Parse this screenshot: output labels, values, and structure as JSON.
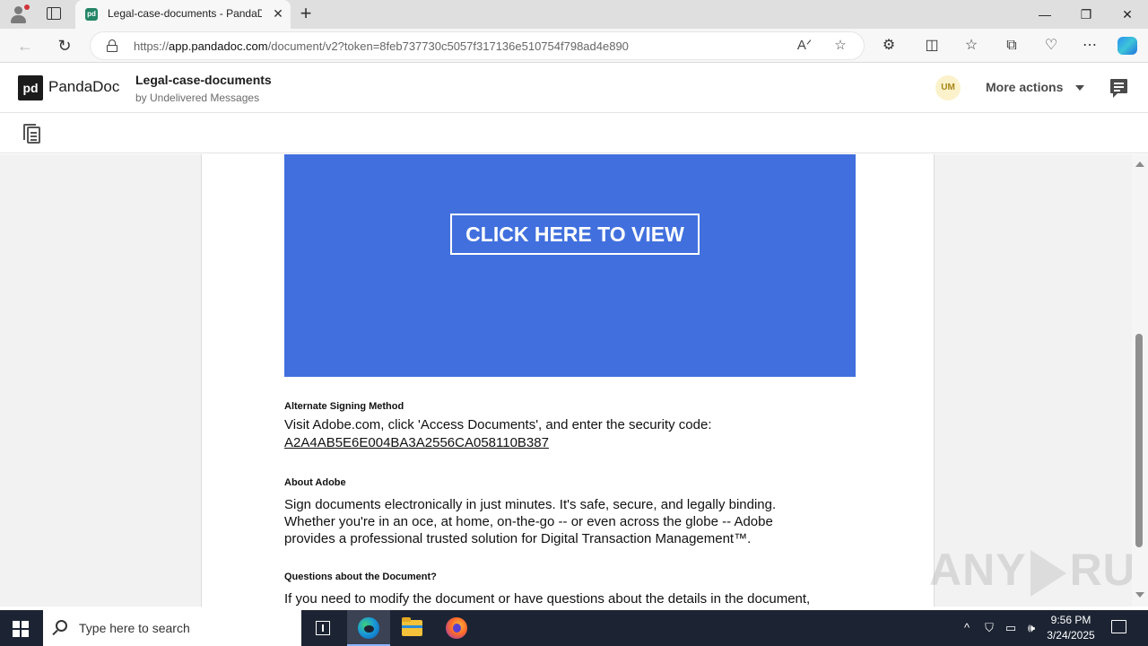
{
  "browser": {
    "tab_title": "Legal-case-documents - PandaDoc",
    "tab_favicon": "pd",
    "tab_close": "✕",
    "new_tab": "+",
    "url_prefix": "https://",
    "url_domain": "app.pandadoc.com",
    "url_path": "/document/v2?token=8feb737730c5057f317136e510754f798ad4e890",
    "window": {
      "minimize": "—",
      "restore": "❐",
      "close": "✕"
    },
    "nav": {
      "back": "←",
      "refresh": "↻"
    },
    "read_aloud": "Aᐟ",
    "favorite": "☆",
    "toolbar_icons": [
      "extensions-icon",
      "split-screen-icon",
      "favorites-icon",
      "collections-icon",
      "performance-icon",
      "more-icon"
    ],
    "toolbar_glyphs": [
      "⚙",
      "◫",
      "☆",
      "⧉",
      "♡",
      "⋯"
    ]
  },
  "pandadoc": {
    "logo_mark": "pd",
    "logo_text": "PandaDoc",
    "doc_title": "Legal-case-documents",
    "doc_subtitle": "by Undelivered Messages",
    "avatar_initials": "UM",
    "more_actions": "More actions"
  },
  "document": {
    "cta_button": "CLICK HERE TO VIEW",
    "alt_heading": "Alternate Signing Method",
    "alt_line1": "Visit Adobe.com, click 'Access Documents', and enter the security code:",
    "alt_code": "A2A4AB5E6E004BA3A2556CA058110B387",
    "about_heading": "About Adobe",
    "about_line1": "Sign documents electronically in just minutes. It's safe, secure, and legally binding.",
    "about_line2": "Whether you're in an oce, at home, on-the-go -- or even across the globe -- Adobe",
    "about_line3": "provides a professional trusted solution for Digital Transaction Management™.",
    "questions_heading": "Questions about the Document?",
    "questions_line1": "If you need to modify the document or have questions about the details in the document,"
  },
  "watermark": {
    "left": "ANY",
    "right": "RUN"
  },
  "taskbar": {
    "search_placeholder": "Type here to search",
    "tray_chevron": "^",
    "time": "9:56 PM",
    "date": "3/24/2025"
  },
  "colors": {
    "cta_panel": "#4170de",
    "brand": "#248567",
    "avatar_bg": "#fbf2cc"
  }
}
